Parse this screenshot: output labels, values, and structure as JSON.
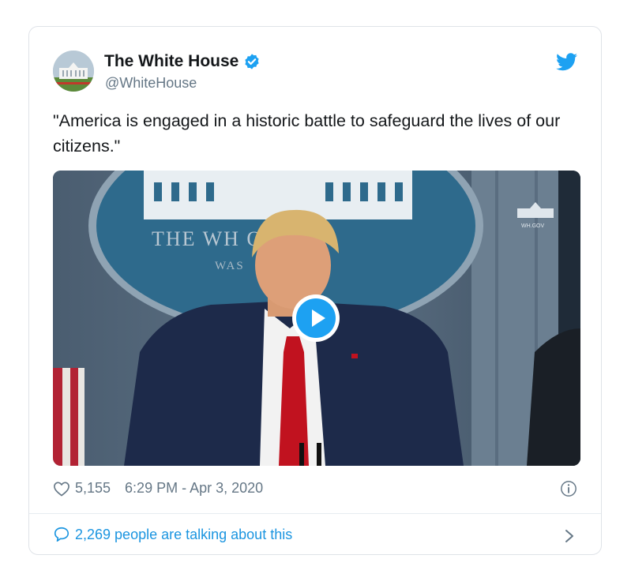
{
  "tweet": {
    "display_name": "The White House",
    "handle": "@WhiteHouse",
    "verified": true,
    "text": "\"America is engaged in a historic battle to safeguard the lives of our citizens.\"",
    "media": {
      "type": "video",
      "seal_text": "THE WH         OUSE",
      "seal_subtext": "WAS",
      "watermark": "WH.GOV"
    },
    "likes": "5,155",
    "timestamp": "6:29 PM - Apr 3, 2020",
    "talking": "2,269 people are talking about this"
  },
  "colors": {
    "accent": "#1da1f2",
    "link": "#1b95e0",
    "muted": "#657786",
    "text": "#14171a"
  },
  "icons": {
    "brand": "twitter-bird-icon",
    "verified": "verified-badge-icon",
    "like": "heart-icon",
    "info": "info-icon",
    "reply": "speech-bubble-icon",
    "more": "chevron-right-icon",
    "play": "play-icon"
  }
}
